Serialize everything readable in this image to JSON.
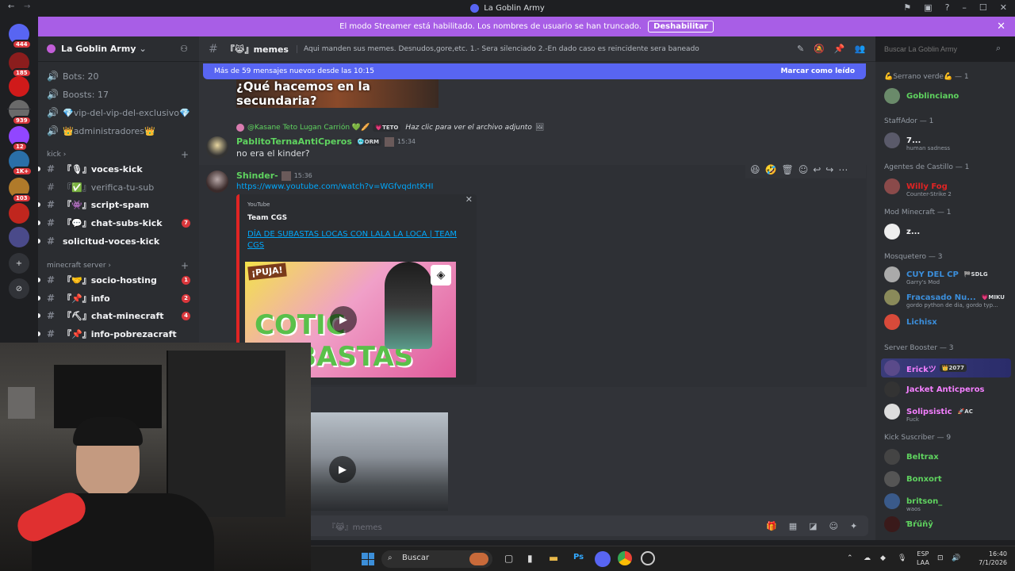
{
  "window": {
    "title": "La Goblin Army"
  },
  "banner": {
    "text": "El modo Streamer está habilitado. Los nombres de usuario se han truncado.",
    "button": "Deshabilitar"
  },
  "servers": [
    {
      "badge": "444",
      "color": "#5865f2"
    },
    {
      "badge": "185",
      "color": "#8b1d1d"
    },
    {
      "badge": "",
      "color": "#d01a1a"
    },
    {
      "badge": "939",
      "color": "#6a6a6a"
    },
    {
      "badge": "12",
      "color": "#9146ff"
    },
    {
      "badge": "1K+",
      "color": "#2a6fa8"
    },
    {
      "badge": "103",
      "color": "#b07a2a"
    },
    {
      "badge": "",
      "color": "#c0261e"
    },
    {
      "badge": "",
      "color": "#4a4a8a"
    }
  ],
  "sidebar": {
    "server_name": "La Goblin Army",
    "channels_top": [
      {
        "label": "Bots: 20"
      },
      {
        "label": "Boosts: 17"
      },
      {
        "label": "💎vip-del-vip-del-exclusivo💎"
      },
      {
        "label": "👑administradores👑"
      }
    ],
    "cat_kick": "kick",
    "kick_channels": [
      {
        "label": "『🎙』voces-kick",
        "badge": ""
      },
      {
        "label": "『✅』verifica-tu-sub",
        "badge": ""
      },
      {
        "label": "『👾』script-spam",
        "badge": ""
      },
      {
        "label": "『💬』chat-subs-kick",
        "badge": "7"
      },
      {
        "label": "solicitud-voces-kick",
        "badge": ""
      }
    ],
    "cat_mc": "minecraft server",
    "mc_channels": [
      {
        "label": "『🤝』socio-hosting",
        "badge": "1"
      },
      {
        "label": "『📌』info",
        "badge": "2"
      },
      {
        "label": "『⛏』chat-minecraft",
        "badge": "4"
      },
      {
        "label": "『📌』info-pobrezacraft",
        "badge": ""
      }
    ]
  },
  "header": {
    "channel": "『😹』memes",
    "topic": "Aqui manden sus memes. Desnudos,gore,etc. 1.- Sera silenciado 2.-En dado caso es reincidente sera baneado",
    "search_placeholder": "Buscar La Goblin Army"
  },
  "newbar": {
    "text": "Más de 59 mensajes nuevos desde las 10:15",
    "mark": "Marcar como leído"
  },
  "messages": {
    "image_caption": "¿Qué hacemos en la secundaria?",
    "m1": {
      "reply_user": "@Kasane Teto Lugan Carrión 💚🥖",
      "reply_tag": "💗TETO",
      "reply_text": "Haz clic para ver el archivo adjunto",
      "author": "PablitoTernaAntiCperos",
      "tag": "🥶ORM",
      "time": "15:34",
      "text": "no era el kinder?",
      "author_color": "#5fd35f"
    },
    "m2": {
      "author": "Shinder-",
      "time": "15:36",
      "link": "https://www.youtube.com/watch?v=WGfvqdntKHI",
      "author_color": "#5fd35f",
      "embed": {
        "provider": "YouTube",
        "author": "Team CGS",
        "title": "DÍA DE SUBASTAS LOCAS CON LALA LA LOCA | TEAM CGS",
        "thumb_top": "¡PUJA!",
        "thumb_big": "COTIC SUBASTAS"
      }
    },
    "input_placeholder": "『😹』memes"
  },
  "members": {
    "roles": [
      {
        "label": "💪Serrano verde💪 — 1"
      },
      {
        "label": "StaffAdor — 1"
      },
      {
        "label": "Agentes de Castillo — 1"
      },
      {
        "label": "Mod Minecraft — 1"
      },
      {
        "label": "Mosquetero — 3"
      },
      {
        "label": "Server Booster — 3"
      },
      {
        "label": "Kick Suscriber — 9"
      }
    ],
    "list": [
      {
        "name": "Goblinciano",
        "status": "",
        "color": "#5fd35f",
        "tag": ""
      },
      {
        "name": "7...",
        "status": "human sadness",
        "color": "#f2f3f5",
        "tag": ""
      },
      {
        "name": "Willy Fog",
        "status": "Counter-Strike 2",
        "color": "#e02424",
        "tag": ""
      },
      {
        "name": "z...",
        "status": "",
        "color": "#f2f3f5",
        "tag": ""
      },
      {
        "name": "CUY DEL CP",
        "status": "Garry's Mod",
        "color": "#3b8edb",
        "tag": "🏁SDLG"
      },
      {
        "name": "Fracasado Nu...",
        "status": "gordo python de dia, gordo typ...",
        "color": "#3b8edb",
        "tag": "💗MIKU"
      },
      {
        "name": "Lichisx",
        "status": "",
        "color": "#3b8edb",
        "tag": ""
      },
      {
        "name": "Erickツ",
        "status": "",
        "color": "#f47fff",
        "tag": "👑2077"
      },
      {
        "name": "Jacket Anticperos",
        "status": "",
        "color": "#f47fff",
        "tag": ""
      },
      {
        "name": "Solipsistic",
        "status": "Fuck",
        "color": "#f47fff",
        "tag": "🚀AC"
      },
      {
        "name": "Beltrax",
        "status": "",
        "color": "#5fd35f",
        "tag": ""
      },
      {
        "name": "Bonxort",
        "status": "",
        "color": "#5fd35f",
        "tag": ""
      },
      {
        "name": "britson_",
        "status": "waos",
        "color": "#5fd35f",
        "tag": ""
      },
      {
        "name": "Ɓŕűňŷ",
        "status": "",
        "color": "#5fd35f",
        "tag": ""
      }
    ]
  },
  "taskbar": {
    "search": "Buscar",
    "lang1": "ESP",
    "lang2": "LAA",
    "time": "16:40",
    "date": "7/1/2026"
  }
}
